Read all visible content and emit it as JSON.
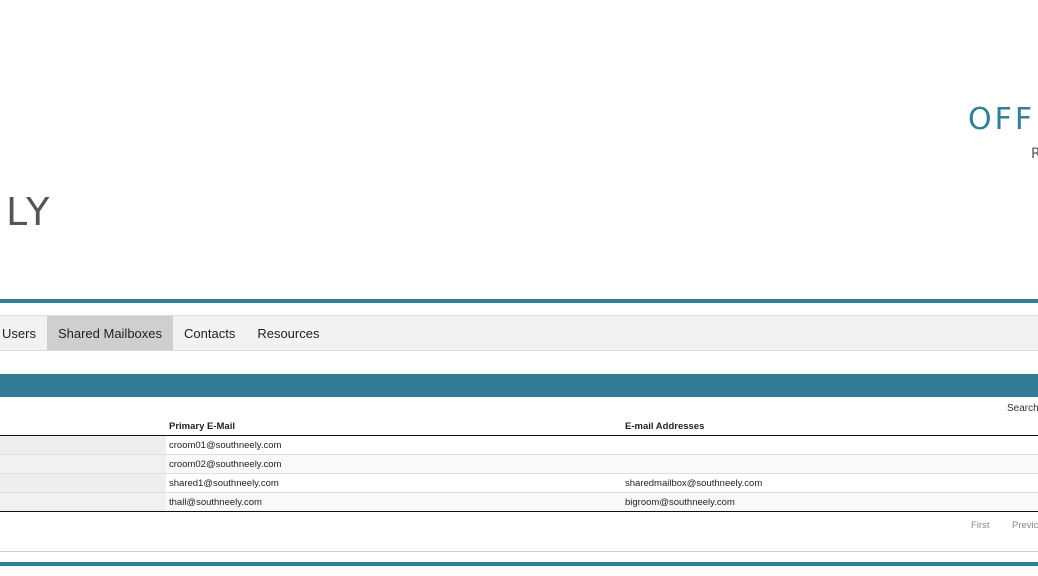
{
  "branding": {
    "left_logo_text": "LY",
    "right_logo_text": "OFFI",
    "right_logo_sub": "R",
    "accent_color": "#2f7f97"
  },
  "tabs": [
    {
      "label": "Users",
      "active": false
    },
    {
      "label": "Shared Mailboxes",
      "active": true
    },
    {
      "label": "Contacts",
      "active": false
    },
    {
      "label": "Resources",
      "active": false
    }
  ],
  "table": {
    "search_label": "Search",
    "columns": [
      "",
      "Primary E-Mail",
      "E-mail Addresses"
    ],
    "rows": [
      {
        "name": "",
        "primary": "croom01@southneely.com",
        "addresses": ""
      },
      {
        "name": "",
        "primary": "croom02@southneely.com",
        "addresses": ""
      },
      {
        "name": "",
        "primary": "shared1@southneely.com",
        "addresses": "sharedmailbox@southneely.com"
      },
      {
        "name": "",
        "primary": "thall@southneely.com",
        "addresses": "bigroom@southneely.com"
      }
    ]
  },
  "pagination": {
    "first_label": "First",
    "prev_label": "Previc"
  }
}
